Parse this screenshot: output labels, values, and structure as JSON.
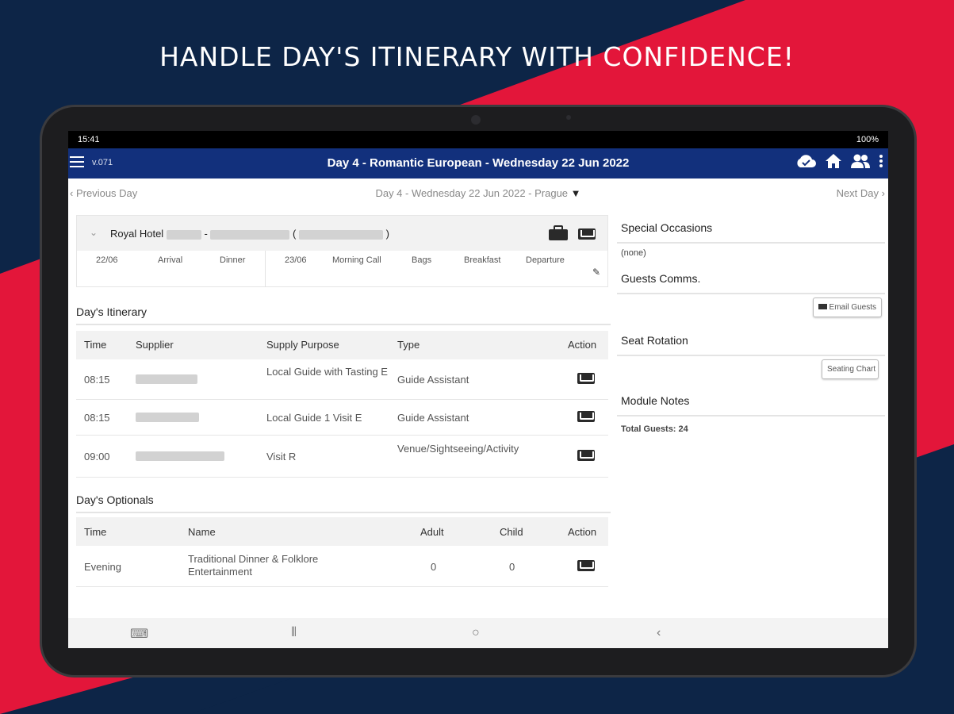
{
  "headline": "HANDLE DAY'S ITINERARY WITH CONFIDENCE!",
  "colors": {
    "navy": "#0d2547",
    "red": "#e3163a",
    "appbar": "#12307c"
  },
  "status": {
    "time": "15:41",
    "battery": "100%"
  },
  "appbar": {
    "version": "v.071",
    "title": "Day 4 - Romantic European - Wednesday 22 Jun 2022",
    "icons": [
      "cloud-check-icon",
      "home-icon",
      "users-icon",
      "more-vert-icon"
    ]
  },
  "nav": {
    "prev": "Previous Day",
    "current": "Day 4 - Wednesday 22 Jun 2022 - Prague",
    "next": "Next Day"
  },
  "hotel": {
    "name": "Royal Hotel",
    "cols": [
      "22/06",
      "Arrival",
      "Dinner",
      "23/06",
      "Morning Call",
      "Bags",
      "Breakfast",
      "Departure"
    ]
  },
  "itinerary": {
    "title": "Day's Itinerary",
    "headers": [
      "Time",
      "Supplier",
      "Supply Purpose",
      "Type",
      "Action"
    ],
    "rows": [
      {
        "time": "08:15",
        "purpose": "Local Guide with Tasting E",
        "type": "Guide Assistant"
      },
      {
        "time": "08:15",
        "purpose": "Local Guide 1 Visit E",
        "type": "Guide Assistant"
      },
      {
        "time": "09:00",
        "purpose": "Visit R",
        "type": "Venue/Sightseeing/Activity"
      }
    ]
  },
  "optionals": {
    "title": "Day's Optionals",
    "headers": [
      "Time",
      "Name",
      "Adult",
      "Child",
      "Action"
    ],
    "rows": [
      {
        "time": "Evening",
        "name": "Traditional Dinner & Folklore Entertainment",
        "adult": "0",
        "child": "0"
      }
    ]
  },
  "right": {
    "special_title": "Special Occasions",
    "special_value": "(none)",
    "comms_title": "Guests Comms.",
    "email_btn": "Email Guests",
    "seat_title": "Seat Rotation",
    "seat_btn": "Seating Chart",
    "notes_title": "Module Notes",
    "total_guests": "Total Guests: 24"
  }
}
